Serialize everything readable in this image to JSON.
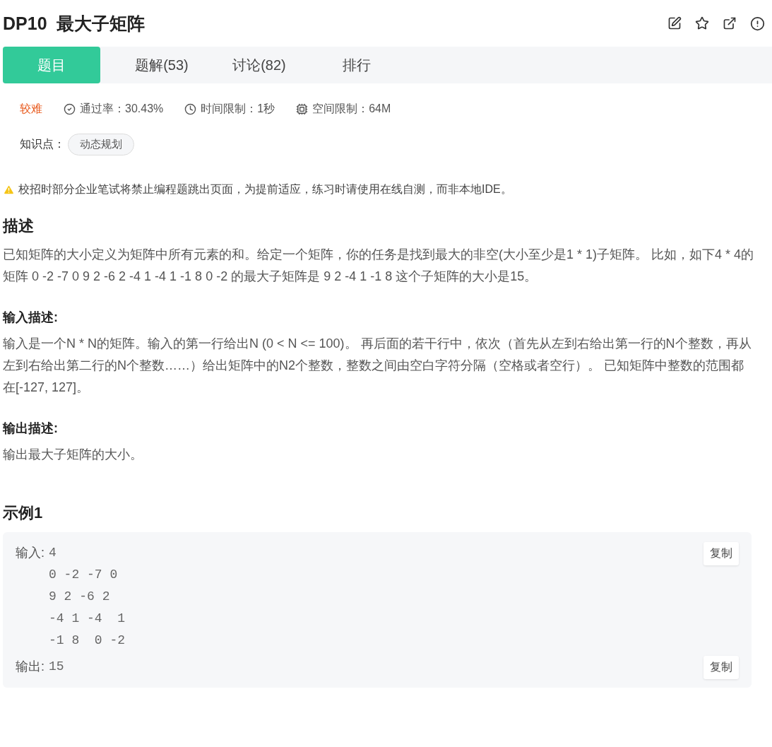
{
  "title": "DP10  最大子矩阵",
  "actions": [
    {
      "kind": "edit"
    },
    {
      "kind": "star"
    },
    {
      "kind": "external"
    },
    {
      "kind": "info"
    }
  ],
  "tabs": [
    {
      "label": "题目",
      "selected": true
    },
    {
      "label": "题解(53)",
      "selected": false
    },
    {
      "label": "讨论(82)",
      "selected": false
    },
    {
      "label": "排行",
      "selected": false
    }
  ],
  "difficulty": "较难",
  "stats": [
    {
      "kind": "pass",
      "text": "通过率：30.43%"
    },
    {
      "kind": "time",
      "text": "时间限制：1秒"
    },
    {
      "kind": "memory",
      "text": "空间限制：64M"
    }
  ],
  "knowledge": {
    "label": "知识点：",
    "tags": [
      "动态规划"
    ]
  },
  "notice": "校招时部分企业笔试将禁止编程题跳出页面，为提前适应，练习时请使用在线自测，而非本地IDE。",
  "sections": [
    {
      "kind": "main",
      "heading": "描述",
      "body": "已知矩阵的大小定义为矩阵中所有元素的和。给定一个矩阵，你的任务是找到最大的非空(大小至少是1 * 1)子矩阵。 比如，如下4 * 4的矩阵 0 -2 -7 0 9 2 -6 2 -4 1 -4 1 -1 8 0 -2 的最大子矩阵是 9 2 -4 1 -1 8 这个子矩阵的大小是15。"
    },
    {
      "kind": "sub",
      "heading": "输入描述:",
      "body": "输入是一个N * N的矩阵。输入的第一行给出N (0 < N <= 100)。 再后面的若干行中，依次（首先从左到右给出第一行的N个整数，再从左到右给出第二行的N个整数……）给出矩阵中的N2个整数，整数之间由空白字符分隔（空格或者空行）。 已知矩阵中整数的范围都在[-127, 127]。"
    },
    {
      "kind": "sub",
      "heading": "输出描述:",
      "body": "输出最大子矩阵的大小。"
    }
  ],
  "example": {
    "heading": "示例1",
    "blocks": [
      {
        "label": "输入:",
        "lines": [
          "4",
          "0 -2 -7 0",
          "9 2 -6 2",
          "-4 1 -4  1",
          "-1 8  0 -2"
        ],
        "copy": "复制"
      },
      {
        "label": "输出:",
        "lines": [
          "15"
        ],
        "copy": "复制"
      }
    ]
  }
}
